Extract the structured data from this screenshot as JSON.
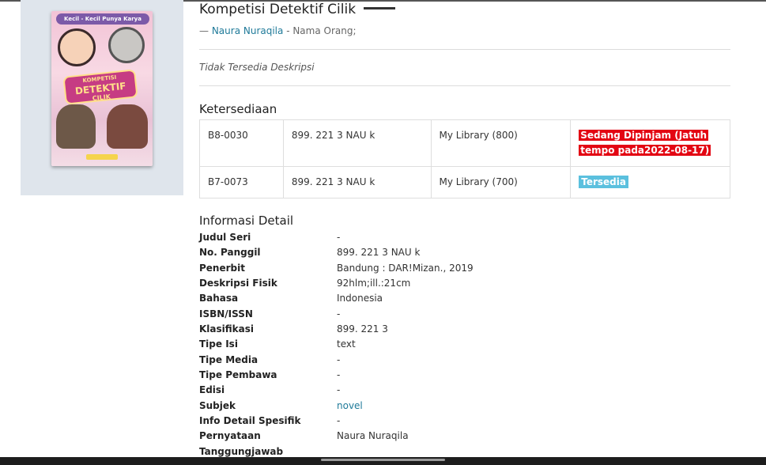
{
  "book": {
    "title": "Kompetisi Detektif Cilik",
    "author_prefix": "— ",
    "author_name": "Naura Nuraqila",
    "author_suffix": " - Nama Orang;",
    "description": "Tidak Tersedia Deskripsi",
    "cover": {
      "series_text": "Kecil - Kecil Punya Karya",
      "title_l1": "KOMPETISI",
      "title_l2": "DETEKTIF",
      "title_l3": "CILIK",
      "colors": {
        "background": "#f2c3d6",
        "badge": "#c63c83",
        "badge_text": "#ffe08a",
        "series_bar": "#7c5aa8"
      }
    }
  },
  "availability": {
    "heading": "Ketersediaan",
    "rows": [
      {
        "code": "B8-0030",
        "call_number": "899. 221 3 NAU k",
        "location": "My Library (800)",
        "status": "Sedang Dipinjam (Jatuh tempo pada2022-08-17)",
        "status_color": "#e30613"
      },
      {
        "code": "B7-0073",
        "call_number": "899. 221 3 NAU k",
        "location": "My Library (700)",
        "status": "Tersedia",
        "status_color": "#5bc0de"
      }
    ]
  },
  "detail": {
    "heading": "Informasi Detail",
    "rows": [
      {
        "key": "Judul Seri",
        "value": "-"
      },
      {
        "key": "No. Panggil",
        "value": "899. 221 3 NAU k"
      },
      {
        "key": "Penerbit",
        "value": "Bandung : DAR!Mizan., 2019"
      },
      {
        "key": "Deskripsi Fisik",
        "value": "92hlm;ill.:21cm"
      },
      {
        "key": "Bahasa",
        "value": "Indonesia"
      },
      {
        "key": "ISBN/ISSN",
        "value": "-"
      },
      {
        "key": "Klasifikasi",
        "value": "899. 221 3"
      },
      {
        "key": "Tipe Isi",
        "value": "text"
      },
      {
        "key": "Tipe Media",
        "value": "-"
      },
      {
        "key": "Tipe Pembawa",
        "value": "-"
      },
      {
        "key": "Edisi",
        "value": "-"
      },
      {
        "key": "Subjek",
        "value": "novel"
      },
      {
        "key": "Info Detail Spesifik",
        "value": "-"
      },
      {
        "key": "Pernyataan",
        "value": "Naura Nuraqila"
      },
      {
        "key": "Tanggungjawab",
        "value": ""
      }
    ]
  },
  "theme": {
    "link_color": "#1f7a99",
    "panel_bg": "#dfe5ec"
  }
}
